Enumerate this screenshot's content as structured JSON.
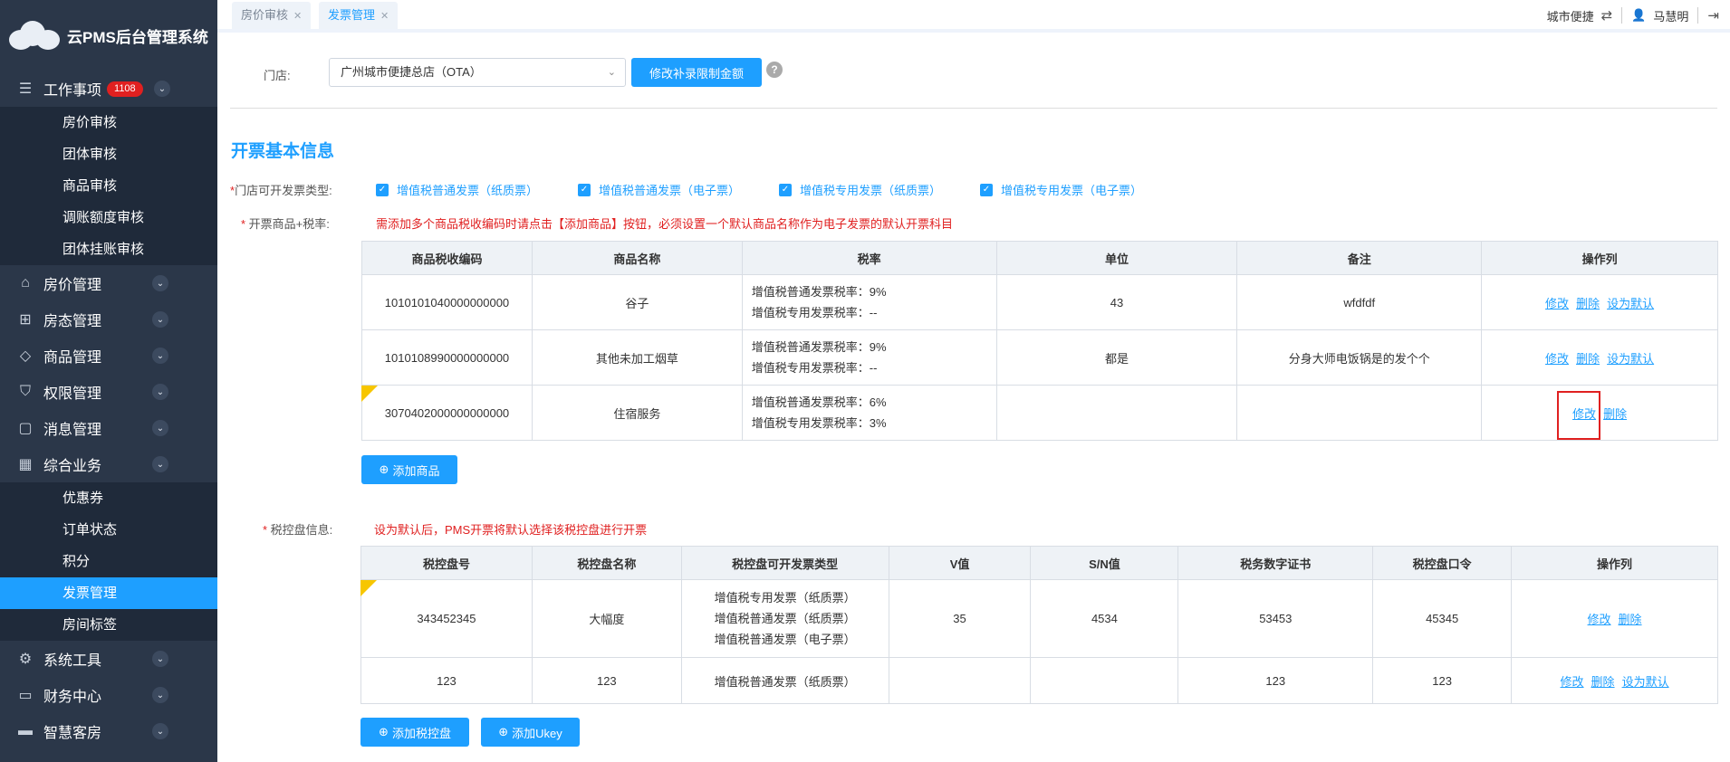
{
  "app": {
    "title": "云PMS后台管理系统"
  },
  "sidebar": {
    "groups": [
      {
        "label": "工作事项",
        "badge": "1108",
        "icon": "list-icon",
        "items": [
          "房价审核",
          "团体审核",
          "商品审核",
          "调账额度审核",
          "团体挂账审核"
        ]
      },
      {
        "label": "房价管理",
        "icon": "house-icon"
      },
      {
        "label": "房态管理",
        "icon": "org-chart-icon"
      },
      {
        "label": "商品管理",
        "icon": "tag-icon"
      },
      {
        "label": "权限管理",
        "icon": "shield-icon"
      },
      {
        "label": "消息管理",
        "icon": "chat-icon"
      },
      {
        "label": "综合业务",
        "icon": "grid-icon",
        "items": [
          "优惠券",
          "订单状态",
          "积分",
          "发票管理",
          "房间标签"
        ],
        "active": "发票管理"
      },
      {
        "label": "系统工具",
        "icon": "gear-icon"
      },
      {
        "label": "财务中心",
        "icon": "monitor-icon"
      },
      {
        "label": "智慧客房",
        "icon": "bed-icon"
      }
    ]
  },
  "tabs": [
    {
      "label": "房价审核"
    },
    {
      "label": "发票管理"
    }
  ],
  "topbar": {
    "hotel": "城市便捷",
    "user": "马慧明"
  },
  "store": {
    "label": "门店:",
    "value": "广州城市便捷总店（OTA）",
    "modify_button": "修改补录限制金额"
  },
  "invoice": {
    "title": "开票基本信息",
    "types_label": "门店可开发票类型:",
    "types": [
      "增值税普通发票（纸质票）",
      "增值税普通发票（电子票）",
      "增值税专用发票（纸质票）",
      "增值税专用发票（电子票）"
    ],
    "goods_label": "开票商品+税率:",
    "goods_warning": "需添加多个商品税收编码时请点击【添加商品】按钮，必须设置一个默认商品名称作为电子发票的默认开票科目",
    "goods_headers": [
      "商品税收编码",
      "商品名称",
      "税率",
      "单位",
      "备注",
      "操作列"
    ],
    "goods_rows": [
      {
        "code": "1010101040000000000",
        "name": "谷子",
        "rate1": "增值税普通发票税率：9%",
        "rate2": "增值税专用发票税率：--",
        "unit": "43",
        "note": "wfdfdf",
        "ops": [
          "修改",
          "删除",
          "设为默认"
        ]
      },
      {
        "code": "1010108990000000000",
        "name": "其他未加工烟草",
        "rate1": "增值税普通发票税率：9%",
        "rate2": "增值税专用发票税率：--",
        "unit": "都是",
        "note": "分身大师电饭锅是的发个个",
        "ops": [
          "修改",
          "删除",
          "设为默认"
        ]
      },
      {
        "code": "3070402000000000000",
        "name": "住宿服务",
        "rate1": "增值税普通发票税率：6%",
        "rate2": "增值税专用发票税率：3%",
        "unit": "",
        "note": "",
        "ops": [
          "修改",
          "删除"
        ]
      }
    ],
    "add_goods": "添加商品",
    "taxdisk_label": "税控盘信息:",
    "taxdisk_warning": "设为默认后，PMS开票将默认选择该税控盘进行开票",
    "disk_headers": [
      "税控盘号",
      "税控盘名称",
      "税控盘可开发票类型",
      "V值",
      "S/N值",
      "税务数字证书",
      "税控盘口令",
      "操作列"
    ],
    "disk_rows": [
      {
        "no": "343452345",
        "name": "大幅度",
        "types": [
          "增值税专用发票（纸质票）",
          "增值税普通发票（纸质票）",
          "增值税普通发票（电子票）"
        ],
        "v": "35",
        "sn": "4534",
        "cert": "53453",
        "pwd": "45345",
        "ops": [
          "修改",
          "删除"
        ]
      },
      {
        "no": "123",
        "name": "123",
        "types": [
          "增值税普通发票（纸质票）"
        ],
        "v": "",
        "sn": "",
        "cert": "123",
        "pwd": "123",
        "ops": [
          "修改",
          "删除",
          "设为默认"
        ]
      }
    ],
    "add_disk": "添加税控盘",
    "add_ukey": "添加Ukey"
  }
}
